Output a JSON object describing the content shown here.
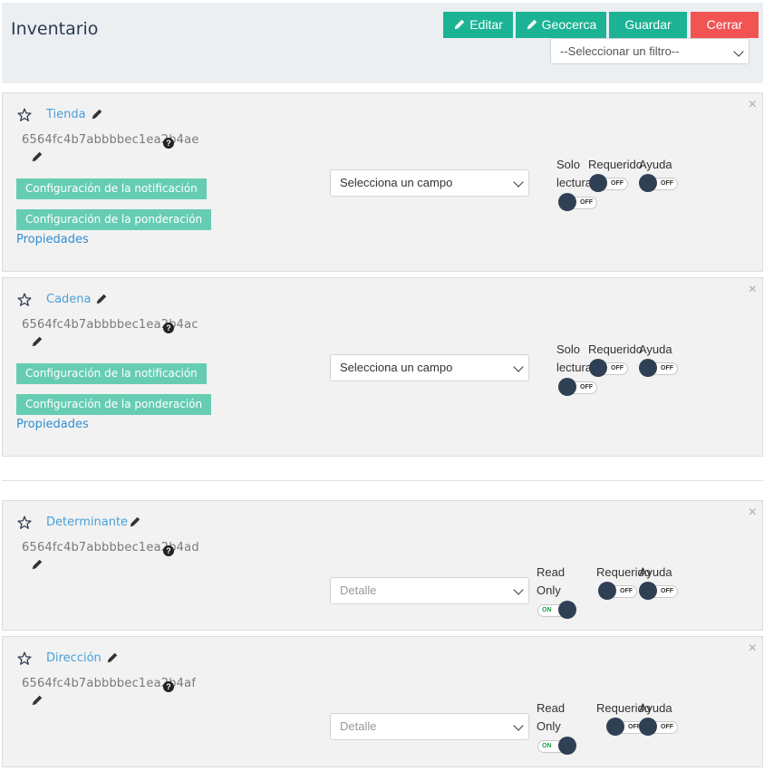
{
  "header": {
    "title": "Inventario",
    "buttons": {
      "edit": "Editar",
      "geofence": "Geocerca",
      "save": "Guardar",
      "close": "Cerrar"
    },
    "filter_placeholder": "--Seleccionar un filtro--"
  },
  "cards": [
    {
      "name": "Tienda",
      "id": "6564fc4b7abbbbec1ea2b4ae",
      "notification_btn": "Configuración de la notificación",
      "weighting_btn": "Configuración de la ponderación",
      "properties_link": "Propiedades",
      "select_value": "Selecciona un campo",
      "label_readonly_1": "Solo",
      "label_readonly_2": "lectura",
      "label_required": "Requerido",
      "label_help": "Ayuda",
      "readonly_state": "OFF",
      "required_state": "OFF",
      "help_state": "OFF"
    },
    {
      "name": "Cadena",
      "id": "6564fc4b7abbbbec1ea2b4ac",
      "notification_btn": "Configuración de la notificación",
      "weighting_btn": "Configuración de la ponderación",
      "properties_link": "Propiedades",
      "select_value": "Selecciona un campo",
      "label_readonly_1": "Solo",
      "label_readonly_2": "lectura",
      "label_required": "Requerido",
      "label_help": "Ayuda",
      "readonly_state": "OFF",
      "required_state": "OFF",
      "help_state": "OFF"
    },
    {
      "name": "Determinante",
      "id": "6564fc4b7abbbbec1ea2b4ad",
      "select_value": "Detalle",
      "label_readonly_1": "Read",
      "label_readonly_2": "Only",
      "label_required": "Requerido",
      "label_help": "Ayuda",
      "readonly_state": "ON",
      "required_state": "OFF",
      "help_state": "OFF"
    },
    {
      "name": "Dirección",
      "id": "6564fc4b7abbbbec1ea2b4af",
      "select_value": "Detalle",
      "label_readonly_1": "Read",
      "label_readonly_2": "Only",
      "label_required": "Requerido",
      "label_help": "Ayuda",
      "readonly_state": "ON",
      "required_state": "OFF",
      "help_state": "OFF"
    }
  ],
  "icons": {
    "star": "star-icon",
    "edit": "pencil-icon",
    "help": "question-icon",
    "close": "close-icon",
    "caret": "chevron-down-icon"
  },
  "colors": {
    "primary": "#1bb394",
    "danger": "#f25454",
    "field_link": "#4a9fd8",
    "action_button": "#66cdb3",
    "toggle_knob": "#2f4054"
  }
}
